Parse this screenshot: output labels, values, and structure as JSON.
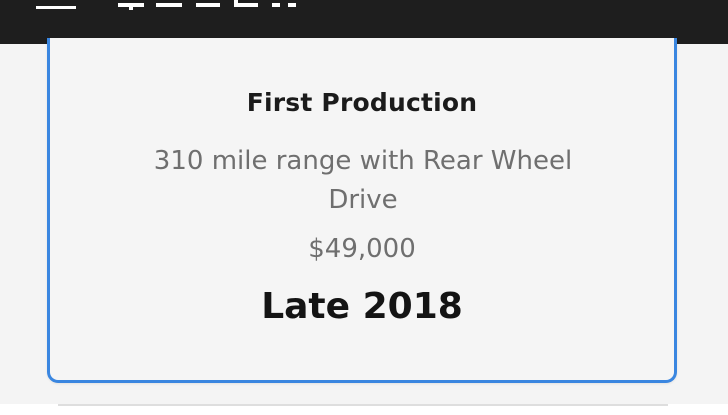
{
  "header": {
    "logo_icon": "tesla-wordmark-logo",
    "menu_icon": "hamburger-menu-icon"
  },
  "card": {
    "title": "First Production",
    "description": "310 mile range with Rear Wheel Drive",
    "price": "$49,000",
    "delivery": "Late 2018",
    "accent_color": "#3a86e0"
  },
  "colors": {
    "topbar": "#1e1e1e",
    "background": "#f4f4f4",
    "title_text": "#1b1b1b",
    "secondary_text": "#6f6f6f"
  }
}
